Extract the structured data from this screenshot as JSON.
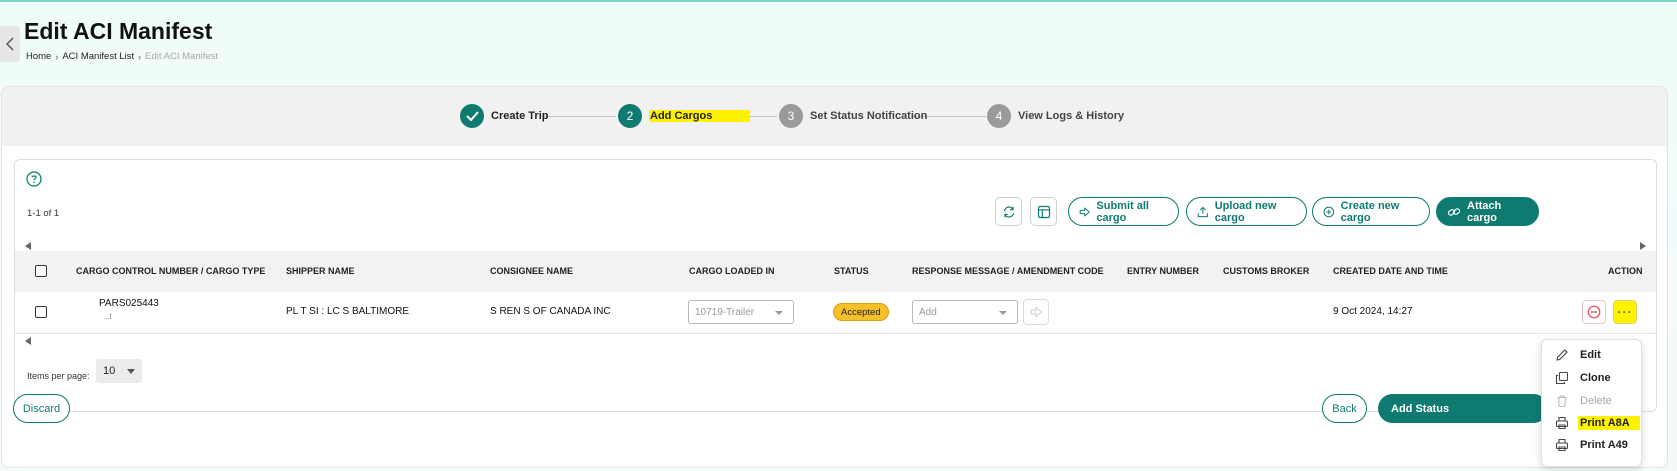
{
  "header": {
    "title": "Edit ACI Manifest",
    "breadcrumb": {
      "home": "Home",
      "list": "ACI Manifest List",
      "current": "Edit ACI Manifest"
    }
  },
  "stepper": {
    "steps": [
      {
        "number": "✓",
        "label": "Create Trip",
        "state": "done"
      },
      {
        "number": "2",
        "label": "Add Cargos",
        "state": "active"
      },
      {
        "number": "3",
        "label": "Set Status Notification",
        "state": "pending"
      },
      {
        "number": "4",
        "label": "View Logs & History",
        "state": "pending"
      }
    ]
  },
  "toolbar": {
    "count": "1-1 of 1",
    "submit_all": "Submit all cargo",
    "upload_new": "Upload new cargo",
    "create_new": "Create new cargo",
    "attach": "Attach cargo"
  },
  "table": {
    "columns": [
      "CARGO CONTROL NUMBER / CARGO TYPE",
      "SHIPPER NAME",
      "CONSIGNEE NAME",
      "CARGO LOADED IN",
      "STATUS",
      "RESPONSE MESSAGE / AMENDMENT CODE",
      "ENTRY NUMBER",
      "CUSTOMS BROKER",
      "CREATED DATE AND TIME",
      "ACTION"
    ],
    "rows": [
      {
        "ccn": "PARS025443",
        "cargo_type": "...t",
        "shipper": "PL    T SI   : LC        S BALTIMORE",
        "consignee": "S        REN     S OF CANADA INC",
        "loaded_in": "10719-Trailer",
        "status": "Accepted",
        "response_placeholder": "Add",
        "entry_number": "",
        "customs_broker": "",
        "created": "9 Oct 2024, 14:27"
      }
    ]
  },
  "pagination": {
    "items_per_page_label": "Items per page:",
    "items_per_page": "10"
  },
  "footer": {
    "discard": "Discard",
    "back": "Back",
    "add_status": "Add Status"
  },
  "action_menu": {
    "items": [
      {
        "label": "Edit",
        "icon": "pencil-icon",
        "disabled": false
      },
      {
        "label": "Clone",
        "icon": "clone-icon",
        "disabled": false
      },
      {
        "label": "Delete",
        "icon": "trash-icon",
        "disabled": true
      },
      {
        "label": "Print A8A",
        "icon": "printer-icon",
        "disabled": false
      },
      {
        "label": "Print A49",
        "icon": "printer-icon",
        "disabled": false
      }
    ]
  },
  "colors": {
    "primary": "#0f7b70",
    "highlight": "#fff200",
    "status_accepted": "#f6c02b",
    "danger": "#e24b4b"
  }
}
